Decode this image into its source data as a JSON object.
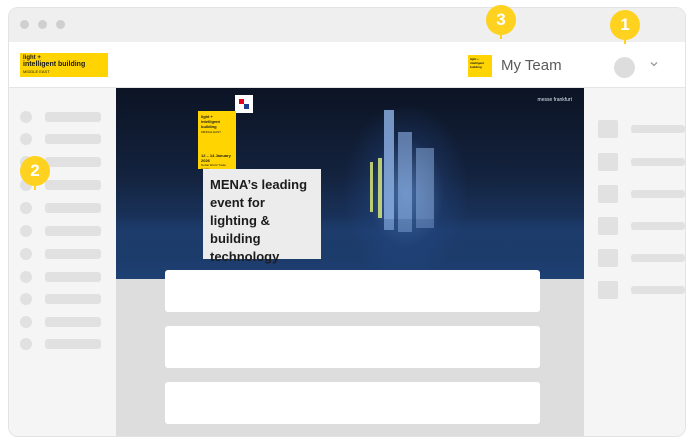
{
  "header": {
    "logo": {
      "line1": "light +",
      "line2": "intelligent building",
      "line3": "MIDDLE EAST"
    },
    "team_logo": {
      "line1": "light +",
      "line2": "intelligent",
      "line3": "building"
    },
    "team_name": "My Team",
    "chevron": "chevron-down-icon"
  },
  "banner": {
    "brand": "messe frankfurt",
    "event": {
      "name_line1": "light +",
      "name_line2": "intelligent building",
      "name_line3": "MIDDLE EAST",
      "dates": "12 – 14 January 2026",
      "venue": "Dubai World Trade Centre"
    },
    "headline": "MENA’s leading event for lighting & building technology"
  },
  "markers": [
    "1",
    "2",
    "3"
  ],
  "colors": {
    "accent": "#ffd21f",
    "brand_yellow": "#ffd400"
  }
}
